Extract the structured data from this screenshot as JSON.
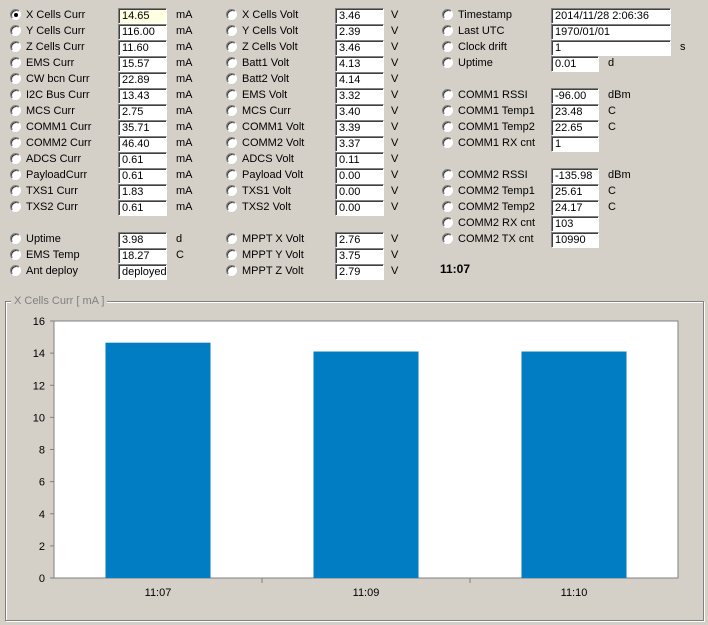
{
  "col1": [
    {
      "label": "X Cells Curr",
      "value": "14.65",
      "unit": "mA",
      "checked": true,
      "highlight": true
    },
    {
      "label": "Y Cells Curr",
      "value": "116.00",
      "unit": "mA"
    },
    {
      "label": "Z Cells Curr",
      "value": "11.60",
      "unit": "mA"
    },
    {
      "label": "EMS Curr",
      "value": "15.57",
      "unit": "mA"
    },
    {
      "label": "CW bcn Curr",
      "value": "22.89",
      "unit": "mA"
    },
    {
      "label": "I2C Bus Curr",
      "value": "13.43",
      "unit": "mA"
    },
    {
      "label": "MCS Curr",
      "value": "2.75",
      "unit": "mA"
    },
    {
      "label": "COMM1 Curr",
      "value": "35.71",
      "unit": "mA"
    },
    {
      "label": "COMM2 Curr",
      "value": "46.40",
      "unit": "mA"
    },
    {
      "label": "ADCS Curr",
      "value": "0.61",
      "unit": "mA"
    },
    {
      "label": "PayloadCurr",
      "value": "0.61",
      "unit": "mA"
    },
    {
      "label": "TXS1 Curr",
      "value": "1.83",
      "unit": "mA"
    },
    {
      "label": "TXS2 Curr",
      "value": "0.61",
      "unit": "mA"
    }
  ],
  "col1b": [
    {
      "label": "Uptime",
      "value": "3.98",
      "unit": "d"
    },
    {
      "label": "EMS Temp",
      "value": "18.27",
      "unit": "C"
    },
    {
      "label": "Ant deploy",
      "value": "deployed",
      "unit": ""
    }
  ],
  "col2": [
    {
      "label": "X Cells Volt",
      "value": "3.46",
      "unit": "V"
    },
    {
      "label": "Y Cells Volt",
      "value": "2.39",
      "unit": "V"
    },
    {
      "label": "Z Cells Volt",
      "value": "3.46",
      "unit": "V"
    },
    {
      "label": "Batt1 Volt",
      "value": "4.13",
      "unit": "V"
    },
    {
      "label": "Batt2 Volt",
      "value": "4.14",
      "unit": "V"
    },
    {
      "label": "EMS Volt",
      "value": "3.32",
      "unit": "V"
    },
    {
      "label": "MCS Curr",
      "value": "3.40",
      "unit": "V"
    },
    {
      "label": "COMM1 Volt",
      "value": "3.39",
      "unit": "V"
    },
    {
      "label": "COMM2 Volt",
      "value": "3.37",
      "unit": "V"
    },
    {
      "label": "ADCS Volt",
      "value": "0.11",
      "unit": "V"
    },
    {
      "label": "Payload Volt",
      "value": "0.00",
      "unit": "V"
    },
    {
      "label": "TXS1 Volt",
      "value": "0.00",
      "unit": "V"
    },
    {
      "label": "TXS2 Volt",
      "value": "0.00",
      "unit": "V"
    }
  ],
  "col2b": [
    {
      "label": "MPPT X Volt",
      "value": "2.76",
      "unit": "V"
    },
    {
      "label": "MPPT Y Volt",
      "value": "3.75",
      "unit": "V"
    },
    {
      "label": "MPPT Z Volt",
      "value": "2.79",
      "unit": "V"
    }
  ],
  "col3a": [
    {
      "label": "Timestamp",
      "value": "2014/11/28 2:06:36",
      "unit": ""
    },
    {
      "label": "Last UTC",
      "value": "1970/01/01",
      "unit": ""
    },
    {
      "label": "Clock drift",
      "value": "1",
      "unit": "s"
    },
    {
      "label": "Uptime",
      "value": "0.01",
      "unit": "d"
    }
  ],
  "col3b": [
    {
      "label": "COMM1 RSSI",
      "value": "-96.00",
      "unit": "dBm"
    },
    {
      "label": "COMM1 Temp1",
      "value": "23.48",
      "unit": "C"
    },
    {
      "label": "COMM1 Temp2",
      "value": "22.65",
      "unit": "C"
    },
    {
      "label": "COMM1 RX cnt",
      "value": "1",
      "unit": ""
    }
  ],
  "col3c": [
    {
      "label": "COMM2 RSSI",
      "value": "-135.98",
      "unit": "dBm"
    },
    {
      "label": "COMM2 Temp1",
      "value": "25.61",
      "unit": "C"
    },
    {
      "label": "COMM2 Temp2",
      "value": "24.17",
      "unit": "C"
    },
    {
      "label": "COMM2 RX cnt",
      "value": "103",
      "unit": ""
    },
    {
      "label": "COMM2 TX cnt",
      "value": "10990",
      "unit": ""
    }
  ],
  "clock": "11:07",
  "chart_title": "X Cells Curr  [ mA ]",
  "colors": {
    "bar": "#007dc3",
    "plot_bg": "#ffffff",
    "window_bg": "#d4d0c8"
  },
  "chart_data": {
    "type": "bar",
    "categories": [
      "11:07",
      "11:09",
      "11:10"
    ],
    "values": [
      14.65,
      14.1,
      14.1
    ],
    "title": "X Cells Curr  [ mA ]",
    "xlabel": "",
    "ylabel": "",
    "ylim": [
      0,
      16
    ],
    "yticks": [
      0,
      2,
      4,
      6,
      8,
      10,
      12,
      14,
      16
    ],
    "grid": false
  }
}
